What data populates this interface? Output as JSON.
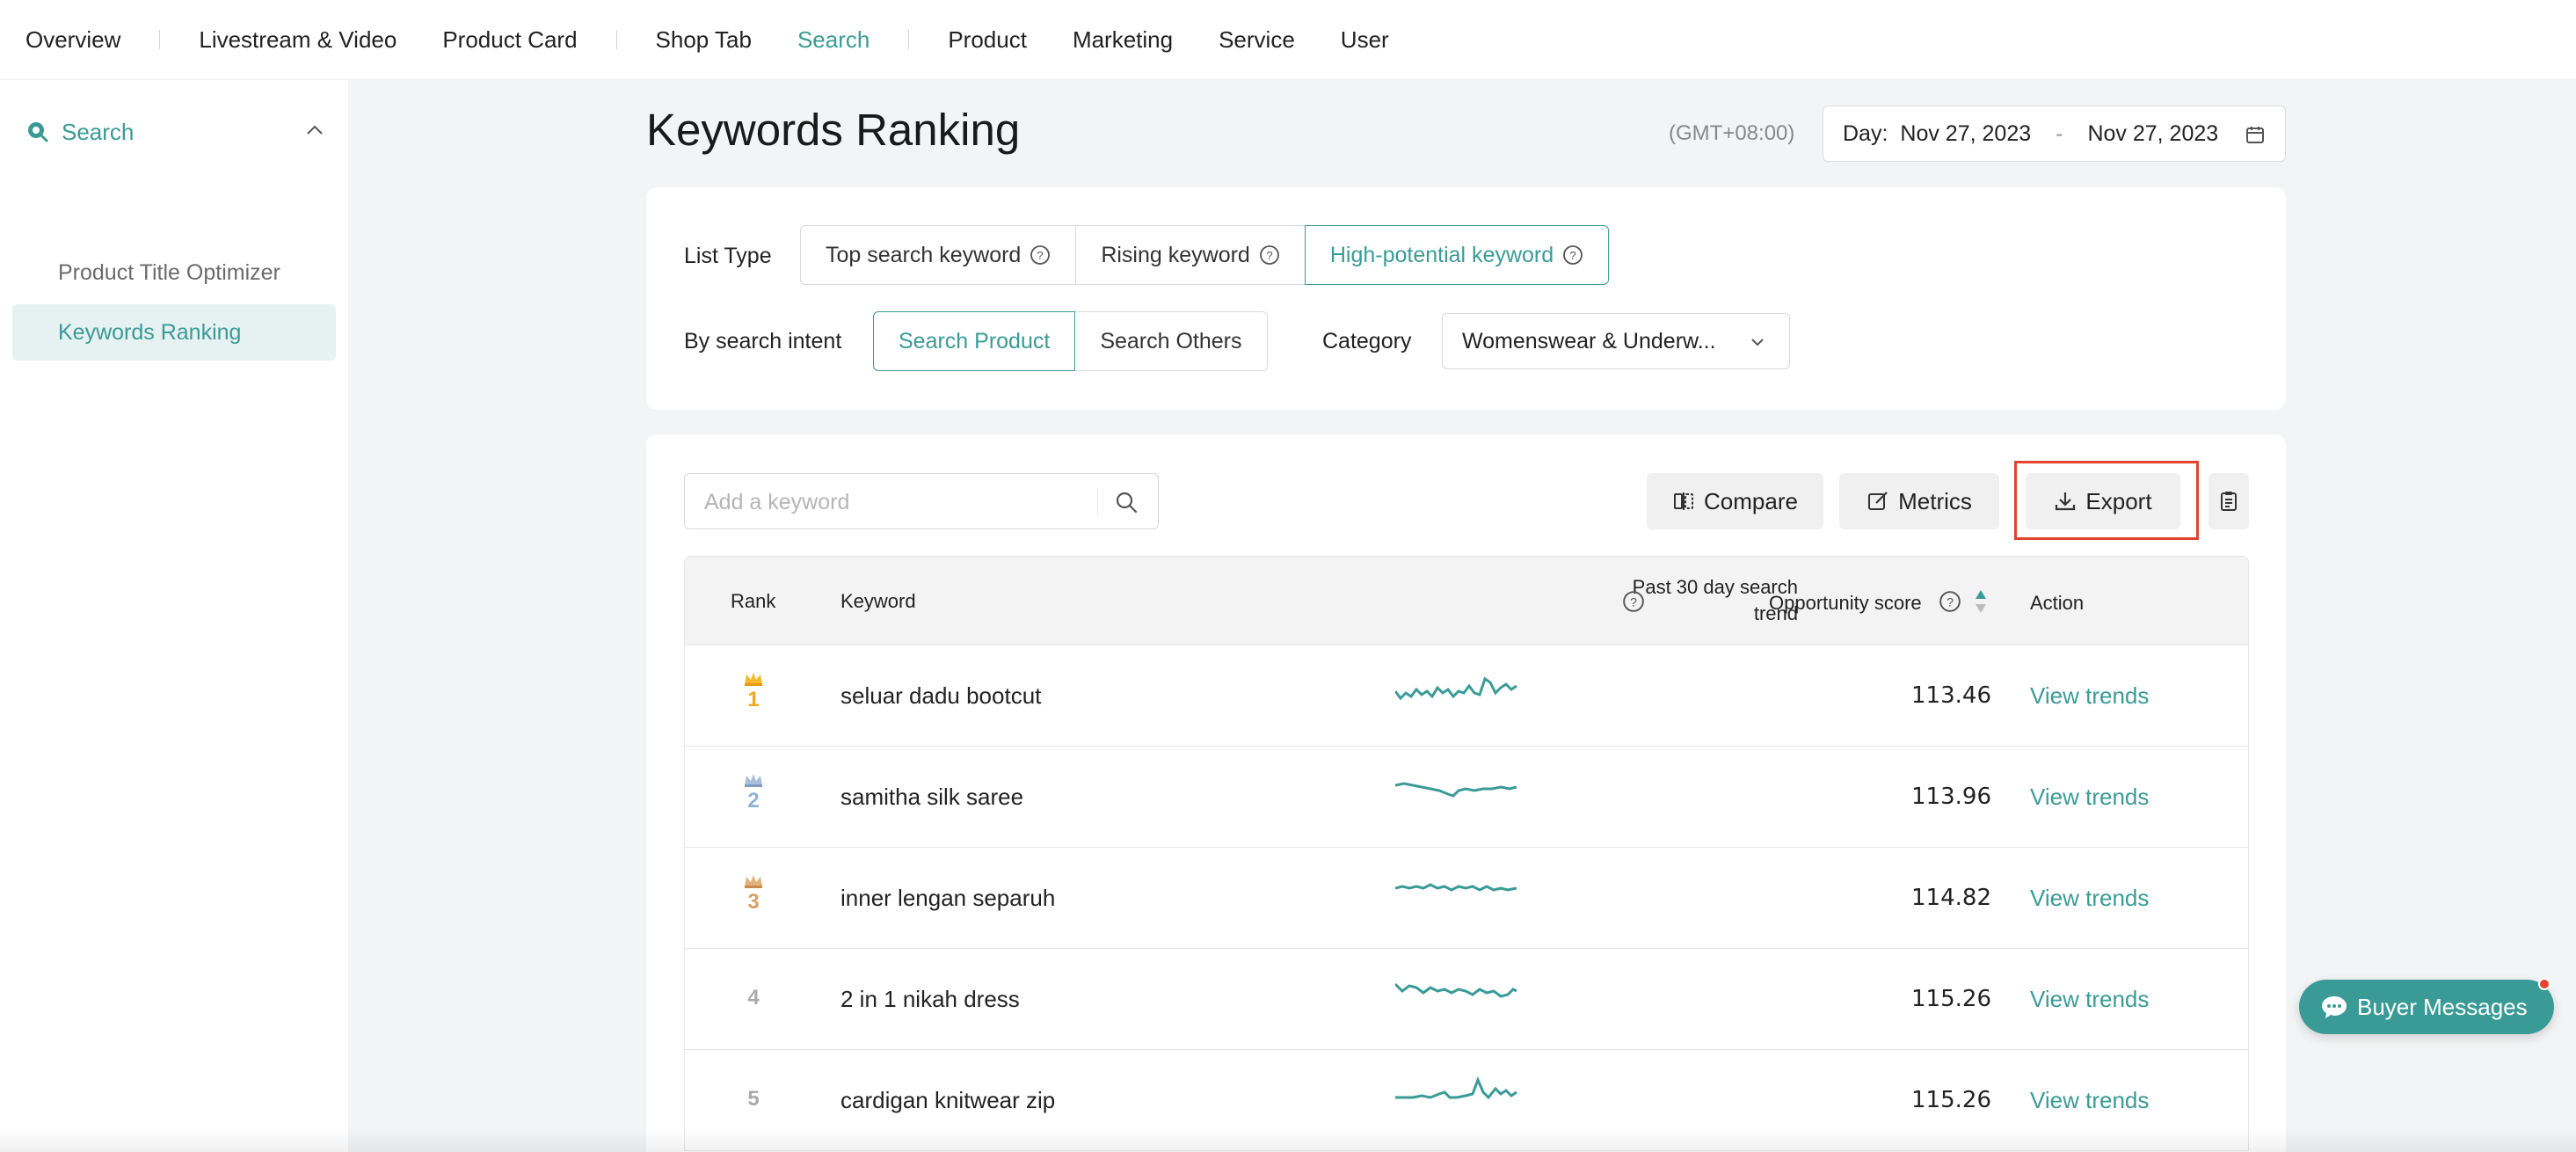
{
  "topnav": {
    "items": [
      "Overview",
      "Livestream & Video",
      "Product Card",
      "Shop Tab",
      "Search",
      "Product",
      "Marketing",
      "Service",
      "User"
    ],
    "active": "Search"
  },
  "sidebar": {
    "section": "Search",
    "items": [
      {
        "label": "Product Title Optimizer",
        "active": false
      },
      {
        "label": "Keywords Ranking",
        "active": true
      }
    ]
  },
  "page": {
    "title": "Keywords Ranking",
    "timezone": "(GMT+08:00)",
    "date": {
      "prefix": "Day:",
      "start": "Nov 27, 2023",
      "separator": "-",
      "end": "Nov 27, 2023"
    }
  },
  "filters": {
    "list_type_label": "List Type",
    "list_types": [
      "Top search keyword",
      "Rising keyword",
      "High-potential keyword"
    ],
    "list_type_active": "High-potential keyword",
    "intent_label": "By search intent",
    "intents": [
      "Search Product",
      "Search Others"
    ],
    "intent_active": "Search Product",
    "category_label": "Category",
    "category_value": "Womenswear & Underw..."
  },
  "toolbar": {
    "search_placeholder": "Add a keyword",
    "compare_label": "Compare",
    "metrics_label": "Metrics",
    "export_label": "Export"
  },
  "table": {
    "headers": {
      "rank": "Rank",
      "keyword": "Keyword",
      "trend_line1": "Past 30 day search",
      "trend_line2": "trend",
      "score": "Opportunity score",
      "action": "Action"
    },
    "rows": [
      {
        "rank": "1",
        "keyword": "seluar dadu bootcut",
        "score": "113.46",
        "action": "View trends"
      },
      {
        "rank": "2",
        "keyword": "samitha silk saree",
        "score": "113.96",
        "action": "View trends"
      },
      {
        "rank": "3",
        "keyword": "inner lengan separuh",
        "score": "114.82",
        "action": "View trends"
      },
      {
        "rank": "4",
        "keyword": "2 in 1 nikah dress",
        "score": "115.26",
        "action": "View trends"
      },
      {
        "rank": "5",
        "keyword": "cardigan knitwear zip",
        "score": "115.26",
        "action": "View trends"
      }
    ]
  },
  "chat": {
    "label": "Buyer Messages"
  },
  "colors": {
    "accent": "#3a9b96",
    "gold": "#f0a81c",
    "silver": "#8fb3d6",
    "bronze": "#d9a066",
    "highlight": "#e0442f"
  }
}
